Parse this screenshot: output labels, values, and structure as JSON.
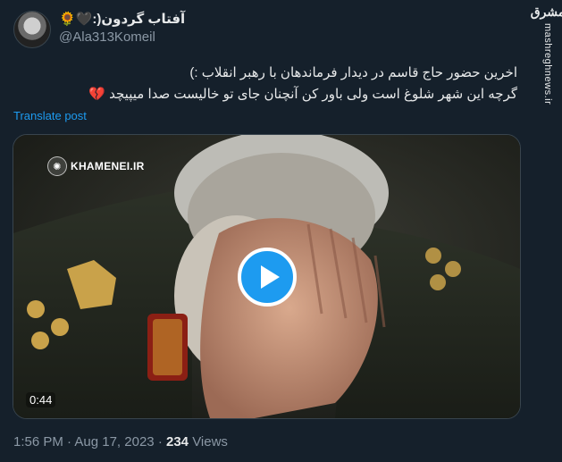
{
  "tweet": {
    "author_name": "آفتاب گردون",
    "author_name_suffix": "🖤:)",
    "author_emoji": "🌻",
    "handle": "@Ala313Komeil",
    "text_line1": "اخرین حضور حاج قاسم در دیدار فرماندهان با رهبر انقلاب :)",
    "text_line2": "گرچه این شهر شلوغ است ولی باور کن آنچنان جای تو خالیست صدا میپیچد 💔",
    "translate_label": "Translate post",
    "time": "1:56 PM",
    "date": "Aug 17, 2023",
    "separator": "·",
    "views_count": "234",
    "views_label": "Views"
  },
  "media": {
    "channel_label": "KHAMENEI.IR",
    "duration": "0:44"
  },
  "watermark": {
    "logo_text": "مشرق",
    "site_text": "mashreghnews.ir"
  },
  "colors": {
    "background": "#15202b",
    "accent": "#1d9bf0",
    "muted": "#8b98a5",
    "text": "#e7e9ea"
  },
  "icons": [
    "play-icon",
    "channel-logo-icon",
    "avatar"
  ]
}
